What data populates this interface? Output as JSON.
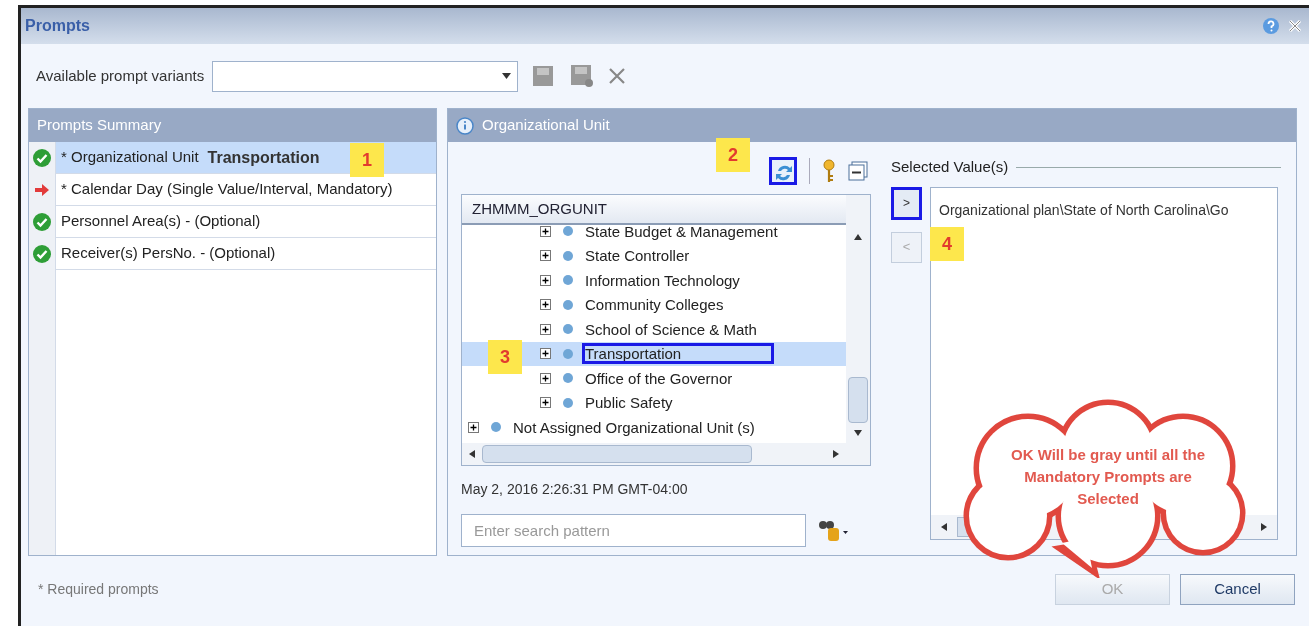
{
  "window": {
    "title": "Prompts"
  },
  "variants": {
    "label": "Available prompt variants"
  },
  "summary": {
    "title": "Prompts Summary",
    "rows": [
      {
        "kind": "ok",
        "label": "* Organizational Unit",
        "value": "Transportation",
        "selected": true
      },
      {
        "kind": "missing",
        "label": "* Calendar Day (Single Value/Interval, Mandatory)",
        "selected": false
      },
      {
        "kind": "ok",
        "label": "Personnel Area(s) - (Optional)",
        "selected": false
      },
      {
        "kind": "ok",
        "label": "Receiver(s) PersNo. - (Optional)",
        "selected": false
      }
    ]
  },
  "detail": {
    "title": "Organizational Unit",
    "tree_header": "ZHMMM_ORGUNIT",
    "tree": [
      {
        "children": [
          {
            "children": [
              {
                "label": "State Budget & Management",
                "expanded": false,
                "selected": false
              },
              {
                "label": "State Controller",
                "expanded": false,
                "selected": false
              },
              {
                "label": "Information Technology",
                "expanded": false,
                "selected": false
              },
              {
                "label": "Community Colleges",
                "expanded": false,
                "selected": false
              },
              {
                "label": "School of Science & Math",
                "expanded": false,
                "selected": false
              },
              {
                "label": "Transportation",
                "expanded": false,
                "selected": true
              },
              {
                "label": "Office of the Governor",
                "expanded": false,
                "selected": false
              },
              {
                "label": "Public Safety",
                "expanded": false,
                "selected": false
              }
            ]
          }
        ]
      },
      {
        "label": "Not Assigned Organizational Unit (s)",
        "expanded": false,
        "selected": false
      }
    ],
    "timestamp": "May 2, 2016 2:26:31 PM GMT-04:00",
    "search": {
      "placeholder": "Enter search pattern"
    },
    "selected_title": "Selected Value(s)",
    "add": ">",
    "remove": "<",
    "selected_values": [
      "Organizational plan\\State of North Carolina\\Go"
    ]
  },
  "footer": {
    "note": "* Required prompts",
    "buttons": [
      {
        "label": "OK",
        "disabled": true
      },
      {
        "label": "Cancel",
        "disabled": false
      }
    ]
  },
  "annotations": {
    "markers": [
      "1",
      "2",
      "3",
      "4"
    ],
    "callout": "OK Will be gray until all the Mandatory Prompts are Selected"
  }
}
